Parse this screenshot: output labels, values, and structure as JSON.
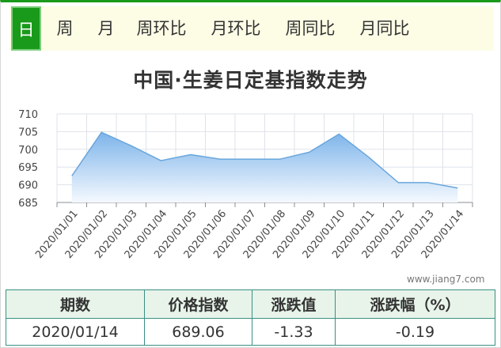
{
  "tabs": [
    {
      "label": "日",
      "active": true
    },
    {
      "label": "周",
      "active": false
    },
    {
      "label": "月",
      "active": false
    },
    {
      "label": "周环比",
      "active": false
    },
    {
      "label": "月环比",
      "active": false
    },
    {
      "label": "周同比",
      "active": false
    },
    {
      "label": "月同比",
      "active": false
    }
  ],
  "chart_title": "中国·生姜日定基指数走势",
  "watermark": "www.jiang7.com",
  "colors": {
    "accent": "#1a9a1a",
    "line": "#6aa6dc",
    "area_top": "#7db4ea",
    "area_bottom": "#f5f9fe",
    "table_border": "#3a8f86",
    "header_bg": "#e8f4ea"
  },
  "chart_data": {
    "type": "area",
    "x": [
      "2020/01/01",
      "2020/01/02",
      "2020/01/03",
      "2020/01/04",
      "2020/01/05",
      "2020/01/06",
      "2020/01/07",
      "2020/01/08",
      "2020/01/09",
      "2020/01/10",
      "2020/01/11",
      "2020/01/12",
      "2020/01/13",
      "2020/01/14"
    ],
    "series": [
      {
        "values": [
          692.5,
          704.8,
          701,
          696.8,
          698.5,
          697.2,
          697.2,
          697.2,
          699.2,
          704.3,
          697.8,
          690.6,
          690.6,
          689.06
        ]
      }
    ],
    "ylim": [
      685,
      710
    ],
    "yticks": [
      "685",
      "690",
      "695",
      "700",
      "705",
      "710"
    ],
    "grid": true
  },
  "table": {
    "headers": [
      "期数",
      "价格指数",
      "涨跌值",
      "涨跌幅（%）"
    ],
    "row": [
      "2020/01/14",
      "689.06",
      "-1.33",
      "-0.19"
    ]
  }
}
